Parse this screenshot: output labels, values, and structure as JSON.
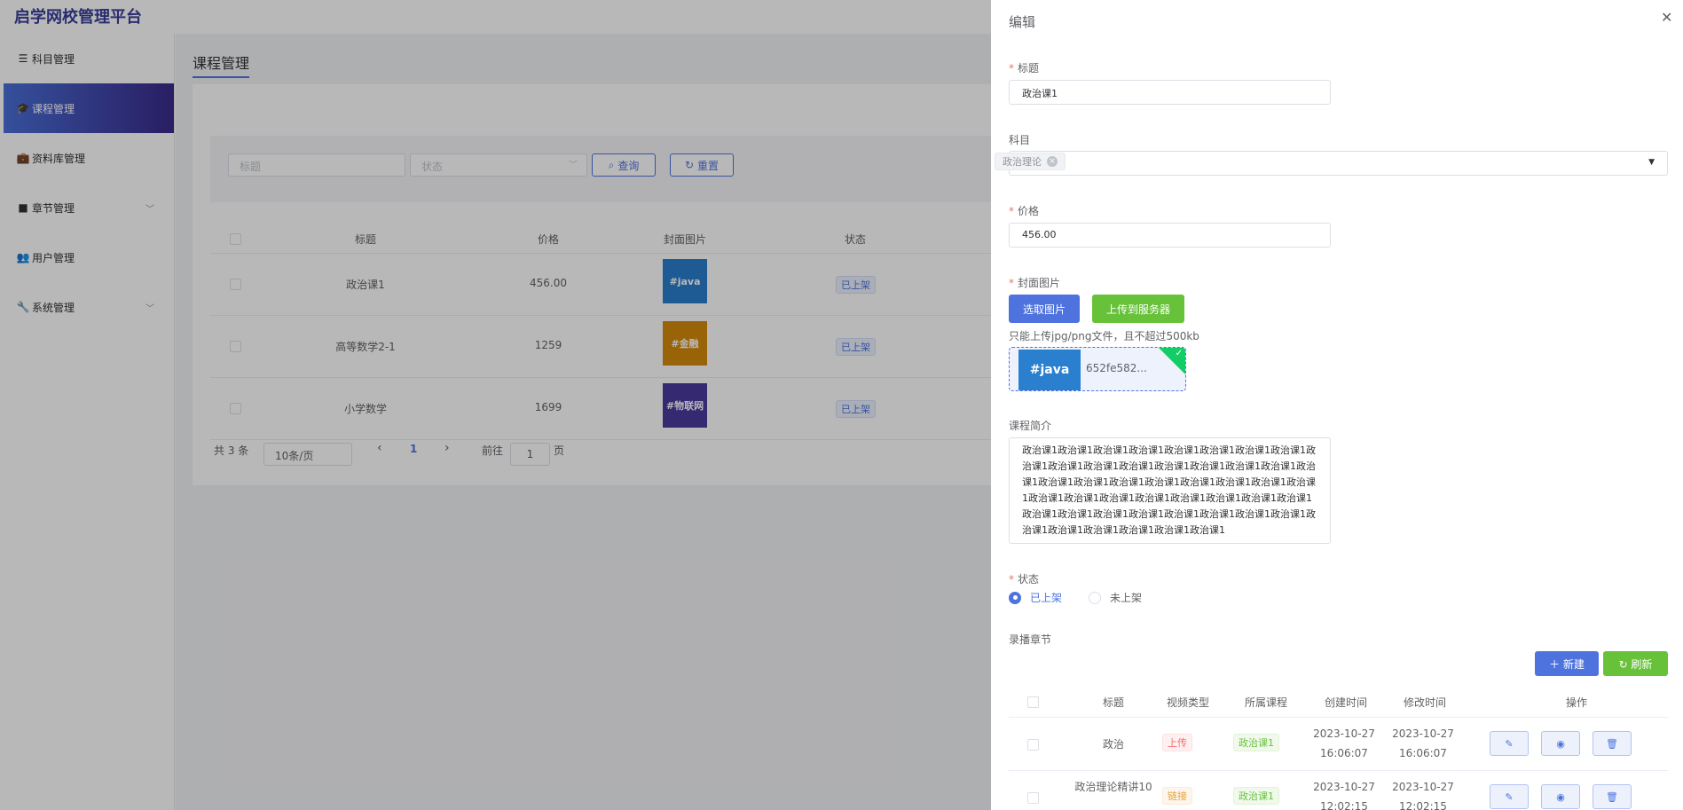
{
  "app": {
    "title": "启学网校管理平台"
  },
  "sidebar": {
    "items": [
      {
        "label": "科目管理",
        "icon": "☰"
      },
      {
        "label": "课程管理",
        "icon": "🎓"
      },
      {
        "label": "资料库管理",
        "icon": "💼"
      },
      {
        "label": "章节管理",
        "icon": "■"
      },
      {
        "label": "用户管理",
        "icon": "👥"
      },
      {
        "label": "系统管理",
        "icon": "🔧"
      }
    ],
    "chevron": "﹀"
  },
  "main": {
    "title": "课程管理",
    "search": {
      "title_placeholder": "标题",
      "status_placeholder": "状态",
      "query_label": "查询",
      "reset_label": "重置",
      "query_icon": "⌕",
      "reset_icon": "↻"
    },
    "table": {
      "headers": [
        "标题",
        "价格",
        "封面图片",
        "状态"
      ],
      "rows": [
        {
          "title": "政治课1",
          "price": "456.00",
          "cover": "#java",
          "cover_color": "#2a7fcf",
          "status": "已上架"
        },
        {
          "title": "高等数学2-1",
          "price": "1259",
          "cover": "#金融",
          "cover_color": "#d4890a",
          "status": "已上架"
        },
        {
          "title": "小学数学",
          "price": "1699",
          "cover": "#物联网",
          "cover_color": "#4a3a9e",
          "status": "已上架"
        }
      ]
    },
    "pager": {
      "total": "共 3 条",
      "size": "10条/页",
      "prev": "‹",
      "page": "1",
      "next": "›",
      "goto": "前往",
      "goto_value": "1",
      "unit": "页"
    }
  },
  "drawer": {
    "title": "编辑",
    "close": "✕",
    "fields": {
      "title_label": "标题",
      "title_value": "政治课1",
      "subject_label": "科目",
      "subject_tag": "政治理论",
      "subject_tag_x": "×",
      "dropdown_arrow": "▼",
      "price_label": "价格",
      "price_value": "456.00",
      "cover_label": "封面图片",
      "choose_btn": "选取图片",
      "upload_btn": "上传到服务器",
      "upload_tip": "只能上传jpg/png文件，且不超过500kb",
      "upload_thumb": "#java",
      "upload_filename": "652fe582...",
      "upload_check": "✓",
      "intro_label": "课程简介",
      "intro_value": "政治课1政治课1政治课1政治课1政治课1政治课1政治课1政治课1政治课1政治课1政治课1政治课1政治课1政治课1政治课1政治课1政治课1政治课1政治课1政治课1政治课1政治课1政治课1政治课1政治课1政治课1政治课1政治课1政治课1政治课1政治课1政治课1政治课1政治课1政治课1政治课1政治课1政治课1政治课1政治课1政治课1政治课1政治课1政治课1政治课1政治课1政治课1",
      "status_label": "状态",
      "status_on": "已上架",
      "status_off": "未上架",
      "chapters_label": "录播章节"
    },
    "chapter_actions": {
      "new": "＋ 新建",
      "refresh": "↻ 刷新"
    },
    "chapter_table": {
      "headers": [
        "标题",
        "视频类型",
        "所属课程",
        "创建时间",
        "修改时间",
        "操作"
      ],
      "rows": [
        {
          "title": "政治",
          "type": "上传",
          "type_color": "red",
          "course": "政治课1",
          "created": "2023-10-27 16:06:07",
          "modified": "2023-10-27 16:06:07"
        },
        {
          "title": "政治理论精讲10",
          "type": "链接",
          "type_color": "orange",
          "course": "政治课1",
          "created": "2023-10-27 12:02:15",
          "modified": "2023-10-27 12:02:15"
        }
      ],
      "action_icons": {
        "edit": "✎",
        "view": "◉",
        "delete": "🗑"
      }
    }
  }
}
